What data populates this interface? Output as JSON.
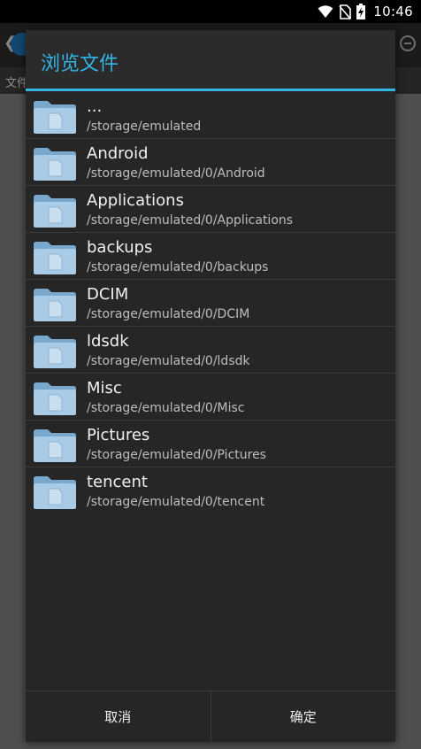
{
  "status_bar": {
    "time": "10:46",
    "icons": [
      "wifi-icon",
      "no-sim-icon",
      "battery-charging-icon"
    ]
  },
  "background_app": {
    "tab_label": "文件"
  },
  "dialog": {
    "title": "浏览文件",
    "accent_color": "#33b5e5",
    "items": [
      {
        "name": "...",
        "path": "/storage/emulated",
        "icon": "folder-icon"
      },
      {
        "name": "Android",
        "path": "/storage/emulated/0/Android",
        "icon": "folder-icon"
      },
      {
        "name": "Applications",
        "path": "/storage/emulated/0/Applications",
        "icon": "folder-icon"
      },
      {
        "name": "backups",
        "path": "/storage/emulated/0/backups",
        "icon": "folder-icon"
      },
      {
        "name": "DCIM",
        "path": "/storage/emulated/0/DCIM",
        "icon": "folder-icon"
      },
      {
        "name": "ldsdk",
        "path": "/storage/emulated/0/ldsdk",
        "icon": "folder-icon"
      },
      {
        "name": "Misc",
        "path": "/storage/emulated/0/Misc",
        "icon": "folder-icon"
      },
      {
        "name": "Pictures",
        "path": "/storage/emulated/0/Pictures",
        "icon": "folder-icon"
      },
      {
        "name": "tencent",
        "path": "/storage/emulated/0/tencent",
        "icon": "folder-icon"
      }
    ],
    "buttons": {
      "cancel": "取消",
      "ok": "确定"
    }
  }
}
